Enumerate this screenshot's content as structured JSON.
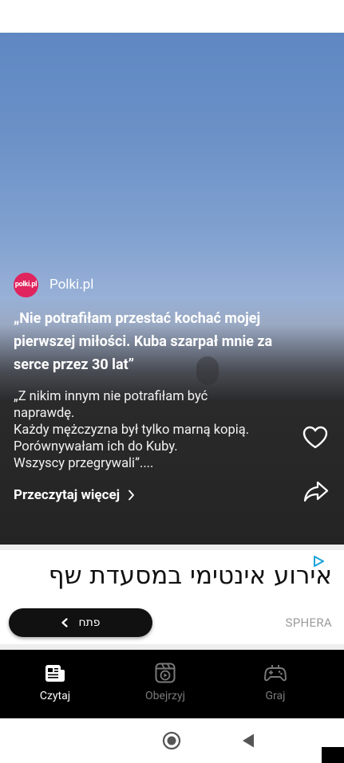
{
  "story": {
    "source_logo_text": "polki.pl",
    "source_name": "Polki.pl",
    "headline": "„Nie potrafiłam przestać kochać mojej pierwszej miłości. Kuba szarpał mnie za serce przez 30 lat”",
    "excerpt": "„Z nikim innym nie potrafiłam być\nnaprawdę.\nKażdy mężczyzna był tylko marną kopią.\nPorównywałam ich do Kuby.\nWszyscy przegrywali”....",
    "read_more": "Przeczytaj więcej",
    "icons": [
      "heart-icon",
      "share-icon",
      "chevron-right-icon"
    ]
  },
  "ad": {
    "headline": "אירוע אינטימי במסעדת שף",
    "cta_label": "פתח",
    "brand": "SPHERA",
    "icons": [
      "ad-choices-icon",
      "chevron-left-icon"
    ]
  },
  "bottom_nav": {
    "items": [
      {
        "label": "Czytaj",
        "icon": "newspaper-icon",
        "active": true
      },
      {
        "label": "Obejrzyj",
        "icon": "video-play-icon",
        "active": false
      },
      {
        "label": "Graj",
        "icon": "gamepad-icon",
        "active": false
      }
    ]
  },
  "system_nav": {
    "icons": [
      "home-circle-icon",
      "back-triangle-icon"
    ]
  },
  "colors": {
    "accent_logo": "#e0245e",
    "nav_background": "#000000",
    "nav_active": "#ffffff",
    "nav_inactive": "#7a7a7a",
    "ad_cta": "#111111"
  }
}
